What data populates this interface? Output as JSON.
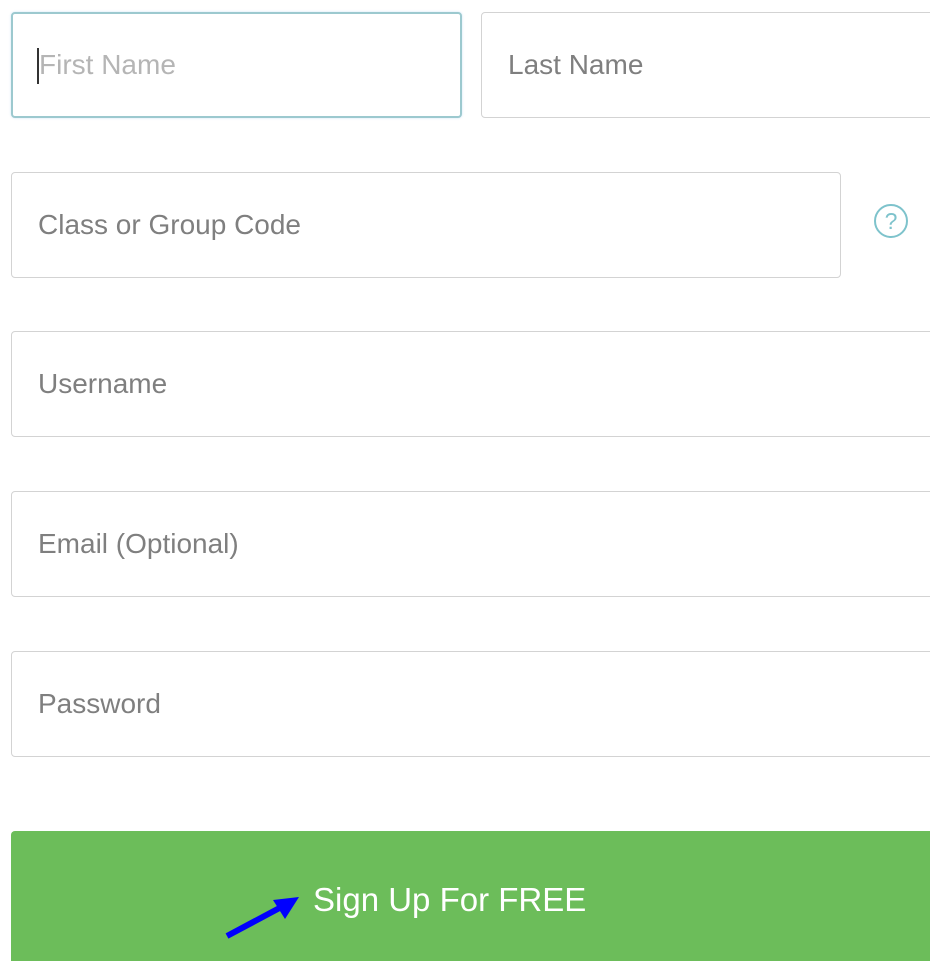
{
  "form": {
    "first_name": {
      "value": "",
      "placeholder": "First Name"
    },
    "last_name": {
      "value": "",
      "placeholder": "Last Name"
    },
    "class_code": {
      "value": "",
      "placeholder": "Class or Group Code"
    },
    "help_icon": {
      "glyph": "?",
      "icon": "question-circle-icon"
    },
    "username": {
      "value": "",
      "placeholder": "Username"
    },
    "email": {
      "value": "",
      "placeholder": "Email (Optional)"
    },
    "password": {
      "value": "",
      "placeholder": "Password"
    },
    "submit_label": "Sign Up For FREE"
  },
  "colors": {
    "button_green": "#6cbd5a",
    "focus_border": "#9cc9cf",
    "help_icon": "#7ec3cc",
    "arrow": "#0000ff"
  }
}
